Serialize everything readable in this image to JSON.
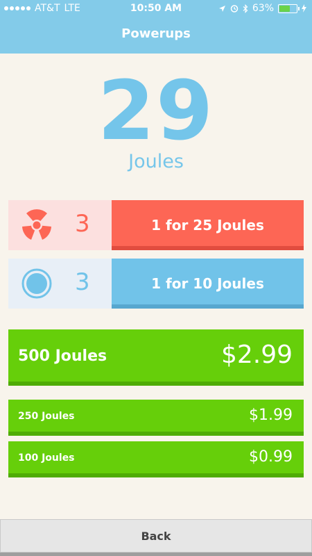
{
  "status_bar": {
    "carrier": "AT&T",
    "network": "LTE",
    "time": "10:50 AM",
    "battery": "63%",
    "battery_level": 0.63
  },
  "header": {
    "title": "Powerups"
  },
  "balance": {
    "amount": "29",
    "unit": "Joules"
  },
  "powerups": [
    {
      "icon": "radiation-icon",
      "quantity": "3",
      "button_label": "1 for 25 Joules",
      "color": "#fd6655"
    },
    {
      "icon": "ring-icon",
      "quantity": "3",
      "button_label": "1 for 10 Joules",
      "color": "#71c3e9"
    }
  ],
  "purchases": [
    {
      "name": "500 Joules",
      "price": "$2.99"
    },
    {
      "name": "250 Joules",
      "price": "$1.99"
    },
    {
      "name": "100 Joules",
      "price": "$0.99"
    }
  ],
  "footer": {
    "back_label": "Back"
  },
  "colors": {
    "header": "#83cbe9",
    "background": "#f8f4ec",
    "buy": "#66cf0a"
  }
}
